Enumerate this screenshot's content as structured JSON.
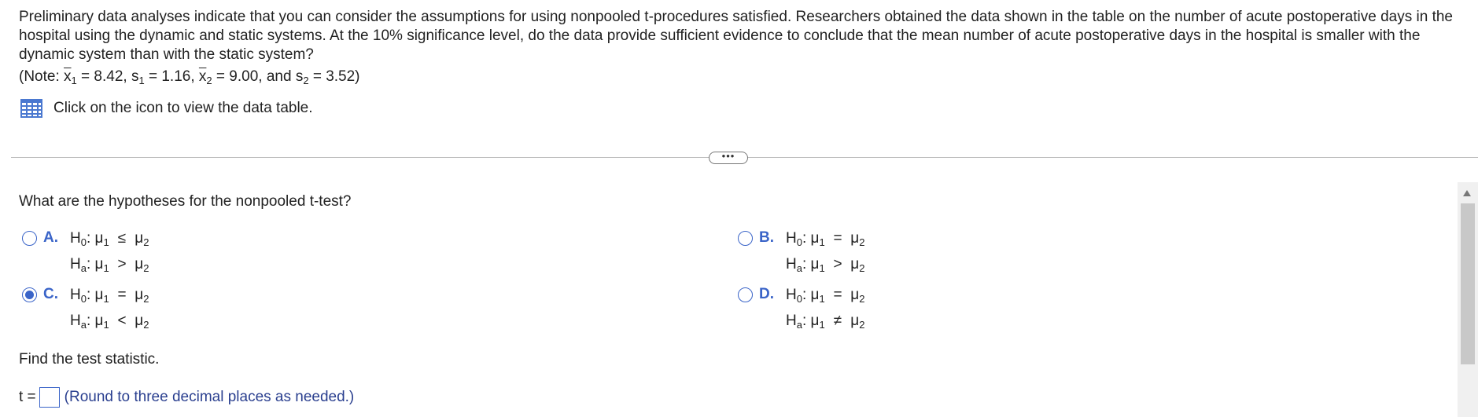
{
  "question": {
    "text": "Preliminary data analyses indicate that you can consider the assumptions for using nonpooled t-procedures satisfied. Researchers obtained the data shown in the table on the number of acute postoperative days in the hospital using the dynamic and static systems. At the 10% significance level, do the data provide sufficient evidence to conclude that the mean number of acute postoperative days in the hospital is smaller with the dynamic system than with the static system?"
  },
  "note": {
    "open": "(Note: ",
    "x1_label": "x",
    "x1_sub": "1",
    "x1_value": " = 8.42, ",
    "s1_label": "s",
    "s1_sub": "1",
    "s1_value": " = 1.16, ",
    "x2_label": "x",
    "x2_sub": "2",
    "x2_value": " = 9.00, and ",
    "s2_label": "s",
    "s2_sub": "2",
    "s2_value": " = 3.52)"
  },
  "view_table": {
    "text": "Click on the icon to view the data table.",
    "icon": "table-grid-icon"
  },
  "more_button": {
    "label": "•••"
  },
  "part1": {
    "prompt": "What are the hypotheses for the nonpooled t-test?",
    "options": [
      {
        "letter": "A.",
        "h0": "≤",
        "ha": ">",
        "selected": false
      },
      {
        "letter": "B.",
        "h0": "=",
        "ha": ">",
        "selected": false
      },
      {
        "letter": "C.",
        "h0": "=",
        "ha": "<",
        "selected": true
      },
      {
        "letter": "D.",
        "h0": "=",
        "ha": "≠",
        "selected": false
      }
    ],
    "h0_label": "H",
    "h0_sub": "0",
    "ha_label": "H",
    "ha_sub": "a",
    "mu": "μ",
    "sub1": "1",
    "sub2": "2"
  },
  "part2": {
    "prompt": "Find the test statistic.",
    "answer_label": "t =",
    "answer_value": "",
    "hint": "(Round to three decimal places as needed.)"
  },
  "colors": {
    "accent": "#3a64c8",
    "hint": "#2a3f8f",
    "divider": "#bcbcbc"
  }
}
